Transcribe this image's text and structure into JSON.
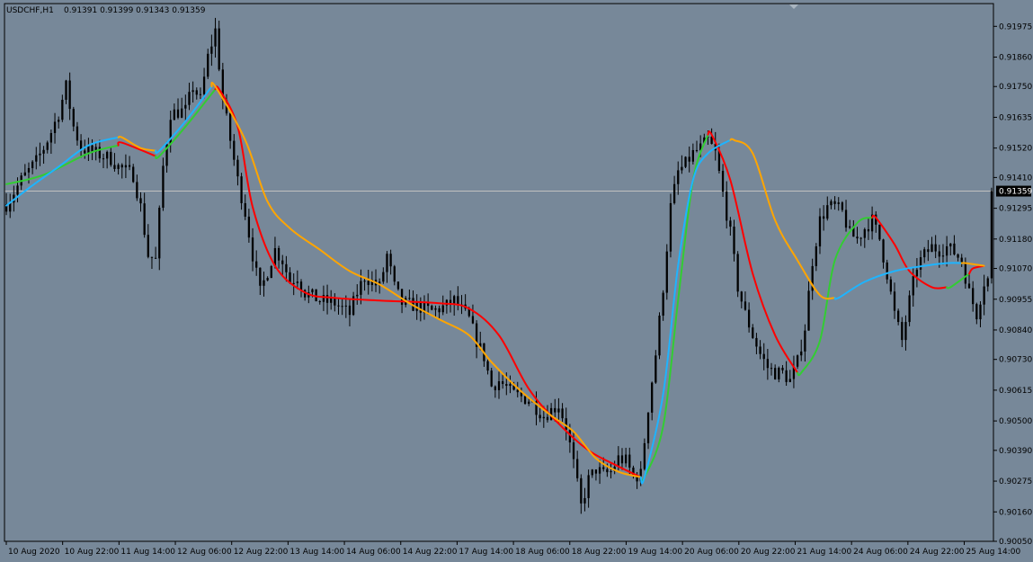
{
  "window": {
    "symbol_timeframe": "USDCHF,H1",
    "ohlc_text": "0.91391 0.91399 0.91343 0.91359"
  },
  "colors": {
    "background": "#778899",
    "candle": "#000000",
    "axis": "#000000",
    "bid_line": "#c0c0c0",
    "price_tag_bg": "#000000",
    "price_tag_text": "#ffffff",
    "ma_up": "#32cd32",
    "ma_down": "#ff0000",
    "ma2_up": "#1eb4ff",
    "ma2_down": "#ffa500"
  },
  "chart_data": {
    "type": "candlestick",
    "symbol": "USDCHF",
    "timeframe": "H1",
    "current_price": 0.91359,
    "y_range": [
      0.9005,
      0.9206
    ],
    "y_ticks": [
      "0.91975",
      "0.91860",
      "0.91750",
      "0.91635",
      "0.91520",
      "0.91410",
      "0.91295",
      "0.91180",
      "0.91070",
      "0.90955",
      "0.90840",
      "0.90730",
      "0.90615",
      "0.90500",
      "0.90390",
      "0.90275",
      "0.90160",
      "0.90050"
    ],
    "x_ticks": [
      "10 Aug 2020",
      "10 Aug 22:00",
      "11 Aug 14:00",
      "12 Aug 06:00",
      "12 Aug 22:00",
      "13 Aug 14:00",
      "14 Aug 06:00",
      "14 Aug 22:00",
      "17 Aug 14:00",
      "18 Aug 06:00",
      "18 Aug 22:00",
      "19 Aug 14:00",
      "20 Aug 06:00",
      "20 Aug 22:00",
      "21 Aug 14:00",
      "24 Aug 06:00",
      "24 Aug 22:00",
      "25 Aug 14:00"
    ],
    "close_path": [
      [
        0,
        0.9131
      ],
      [
        4,
        0.914
      ],
      [
        8,
        0.9147
      ],
      [
        10,
        0.9152
      ],
      [
        12,
        0.9158
      ],
      [
        14,
        0.9165
      ],
      [
        16,
        0.9175
      ],
      [
        18,
        0.916
      ],
      [
        20,
        0.9152
      ],
      [
        24,
        0.915
      ],
      [
        28,
        0.9148
      ],
      [
        30,
        0.9145
      ],
      [
        34,
        0.9142
      ],
      [
        36,
        0.913
      ],
      [
        38,
        0.9112
      ],
      [
        40,
        0.911
      ],
      [
        42,
        0.9145
      ],
      [
        44,
        0.9165
      ],
      [
        48,
        0.9166
      ],
      [
        50,
        0.9175
      ],
      [
        52,
        0.917
      ],
      [
        54,
        0.9186
      ],
      [
        56,
        0.9196
      ],
      [
        58,
        0.917
      ],
      [
        60,
        0.9155
      ],
      [
        62,
        0.914
      ],
      [
        64,
        0.9128
      ],
      [
        66,
        0.9112
      ],
      [
        68,
        0.9098
      ],
      [
        70,
        0.9106
      ],
      [
        72,
        0.9114
      ],
      [
        74,
        0.911
      ],
      [
        76,
        0.9102
      ],
      [
        78,
        0.9104
      ],
      [
        80,
        0.9098
      ],
      [
        84,
        0.9095
      ],
      [
        88,
        0.9094
      ],
      [
        92,
        0.909
      ],
      [
        94,
        0.9098
      ],
      [
        96,
        0.9104
      ],
      [
        100,
        0.91
      ],
      [
        102,
        0.9112
      ],
      [
        104,
        0.91
      ],
      [
        106,
        0.9094
      ],
      [
        110,
        0.9093
      ],
      [
        114,
        0.9091
      ],
      [
        118,
        0.9093
      ],
      [
        120,
        0.9095
      ],
      [
        124,
        0.9088
      ],
      [
        126,
        0.908
      ],
      [
        128,
        0.9074
      ],
      [
        130,
        0.9063
      ],
      [
        132,
        0.9065
      ],
      [
        136,
        0.906
      ],
      [
        140,
        0.9058
      ],
      [
        144,
        0.9052
      ],
      [
        148,
        0.9056
      ],
      [
        150,
        0.9048
      ],
      [
        152,
        0.9034
      ],
      [
        154,
        0.9018
      ],
      [
        156,
        0.9028
      ],
      [
        158,
        0.9032
      ],
      [
        160,
        0.903
      ],
      [
        162,
        0.9031
      ],
      [
        164,
        0.9036
      ],
      [
        166,
        0.9035
      ],
      [
        168,
        0.9029
      ],
      [
        170,
        0.903
      ],
      [
        172,
        0.9055
      ],
      [
        174,
        0.9075
      ],
      [
        176,
        0.91
      ],
      [
        178,
        0.913
      ],
      [
        180,
        0.9143
      ],
      [
        182,
        0.9146
      ],
      [
        184,
        0.915
      ],
      [
        186,
        0.9152
      ],
      [
        188,
        0.9155
      ],
      [
        190,
        0.915
      ],
      [
        192,
        0.9135
      ],
      [
        194,
        0.912
      ],
      [
        196,
        0.91
      ],
      [
        198,
        0.909
      ],
      [
        200,
        0.9082
      ],
      [
        202,
        0.9075
      ],
      [
        204,
        0.907
      ],
      [
        206,
        0.9068
      ],
      [
        208,
        0.9068
      ],
      [
        210,
        0.9065
      ],
      [
        212,
        0.9072
      ],
      [
        214,
        0.9085
      ],
      [
        216,
        0.911
      ],
      [
        218,
        0.9125
      ],
      [
        220,
        0.913
      ],
      [
        222,
        0.913
      ],
      [
        224,
        0.9128
      ],
      [
        226,
        0.912
      ],
      [
        228,
        0.9118
      ],
      [
        230,
        0.9122
      ],
      [
        232,
        0.9125
      ],
      [
        234,
        0.9118
      ],
      [
        236,
        0.9105
      ],
      [
        238,
        0.909
      ],
      [
        240,
        0.908
      ],
      [
        242,
        0.9095
      ],
      [
        244,
        0.9108
      ],
      [
        246,
        0.9112
      ],
      [
        248,
        0.9115
      ],
      [
        250,
        0.9114
      ],
      [
        252,
        0.9115
      ],
      [
        254,
        0.9113
      ],
      [
        256,
        0.911
      ],
      [
        258,
        0.9098
      ],
      [
        260,
        0.909
      ],
      [
        262,
        0.9102
      ],
      [
        264,
        0.9104
      ]
    ],
    "bar_count": 265,
    "series": [
      {
        "line_color_up": "#32cd32",
        "line_color_down": "#ff0000",
        "points": [
          [
            0,
            0.91385,
            "up"
          ],
          [
            10,
            0.9142,
            "up"
          ],
          [
            22,
            0.915,
            "up"
          ],
          [
            30,
            0.9153,
            "up"
          ],
          [
            31,
            0.9154,
            "down"
          ],
          [
            40,
            0.9149,
            "down"
          ],
          [
            41,
            0.9149,
            "up"
          ],
          [
            48,
            0.916,
            "up"
          ],
          [
            56,
            0.9174,
            "up"
          ],
          [
            57,
            0.9174,
            "down"
          ],
          [
            62,
            0.916,
            "down"
          ],
          [
            66,
            0.913,
            "down"
          ],
          [
            72,
            0.9108,
            "down"
          ],
          [
            80,
            0.9098,
            "down"
          ],
          [
            88,
            0.9096,
            "down"
          ],
          [
            100,
            0.9095,
            "down"
          ],
          [
            116,
            0.9094,
            "down"
          ],
          [
            124,
            0.9092,
            "down"
          ],
          [
            132,
            0.9082,
            "down"
          ],
          [
            140,
            0.9062,
            "down"
          ],
          [
            148,
            0.9049,
            "down"
          ],
          [
            156,
            0.9039,
            "down"
          ],
          [
            164,
            0.9033,
            "down"
          ],
          [
            170,
            0.9029,
            "down"
          ],
          [
            171,
            0.9029,
            "up"
          ],
          [
            176,
            0.9048,
            "up"
          ],
          [
            180,
            0.9095,
            "up"
          ],
          [
            184,
            0.914,
            "up"
          ],
          [
            188,
            0.9157,
            "up"
          ],
          [
            189,
            0.9157,
            "down"
          ],
          [
            194,
            0.914,
            "down"
          ],
          [
            200,
            0.9105,
            "down"
          ],
          [
            206,
            0.9082,
            "down"
          ],
          [
            212,
            0.9068,
            "down"
          ],
          [
            213,
            0.9068,
            "up"
          ],
          [
            218,
            0.908,
            "up"
          ],
          [
            222,
            0.911,
            "up"
          ],
          [
            228,
            0.9124,
            "up"
          ],
          [
            232,
            0.9126,
            "up"
          ],
          [
            233,
            0.9126,
            "down"
          ],
          [
            238,
            0.9116,
            "down"
          ],
          [
            242,
            0.9106,
            "down"
          ],
          [
            248,
            0.91,
            "down"
          ],
          [
            252,
            0.91,
            "down"
          ],
          [
            253,
            0.91,
            "up"
          ],
          [
            258,
            0.9105,
            "up"
          ],
          [
            259,
            0.9107,
            "down"
          ],
          [
            262,
            0.9108,
            "down"
          ]
        ]
      },
      {
        "line_color_up": "#1eb4ff",
        "line_color_down": "#ffa500",
        "points": [
          [
            0,
            0.91305,
            "up"
          ],
          [
            6,
            0.9137,
            "up"
          ],
          [
            14,
            0.9145,
            "up"
          ],
          [
            22,
            0.9153,
            "up"
          ],
          [
            30,
            0.9156,
            "up"
          ],
          [
            31,
            0.9156,
            "down"
          ],
          [
            36,
            0.9152,
            "down"
          ],
          [
            40,
            0.9151,
            "down"
          ],
          [
            41,
            0.9151,
            "up"
          ],
          [
            48,
            0.9162,
            "up"
          ],
          [
            55,
            0.9175,
            "up"
          ],
          [
            56,
            0.9175,
            "down"
          ],
          [
            64,
            0.9155,
            "down"
          ],
          [
            70,
            0.9132,
            "down"
          ],
          [
            76,
            0.9122,
            "down"
          ],
          [
            84,
            0.9114,
            "down"
          ],
          [
            92,
            0.9106,
            "down"
          ],
          [
            100,
            0.9101,
            "down"
          ],
          [
            108,
            0.9094,
            "down"
          ],
          [
            116,
            0.9088,
            "down"
          ],
          [
            124,
            0.9082,
            "down"
          ],
          [
            130,
            0.9072,
            "down"
          ],
          [
            138,
            0.9061,
            "down"
          ],
          [
            146,
            0.9052,
            "down"
          ],
          [
            152,
            0.9046,
            "down"
          ],
          [
            158,
            0.9036,
            "down"
          ],
          [
            164,
            0.9031,
            "down"
          ],
          [
            170,
            0.9029,
            "down"
          ],
          [
            171,
            0.9029,
            "up"
          ],
          [
            176,
            0.906,
            "up"
          ],
          [
            180,
            0.9108,
            "up"
          ],
          [
            184,
            0.914,
            "up"
          ],
          [
            188,
            0.915,
            "up"
          ],
          [
            194,
            0.9155,
            "up"
          ],
          [
            195,
            0.9155,
            "down"
          ],
          [
            200,
            0.915,
            "down"
          ],
          [
            206,
            0.9125,
            "down"
          ],
          [
            212,
            0.911,
            "down"
          ],
          [
            218,
            0.9097,
            "down"
          ],
          [
            222,
            0.9096,
            "down"
          ],
          [
            223,
            0.9096,
            "up"
          ],
          [
            230,
            0.9102,
            "up"
          ],
          [
            238,
            0.9106,
            "up"
          ],
          [
            246,
            0.9108,
            "up"
          ],
          [
            252,
            0.9109,
            "up"
          ],
          [
            256,
            0.9109,
            "up"
          ],
          [
            257,
            0.9109,
            "down"
          ],
          [
            262,
            0.9108,
            "down"
          ]
        ]
      }
    ]
  }
}
